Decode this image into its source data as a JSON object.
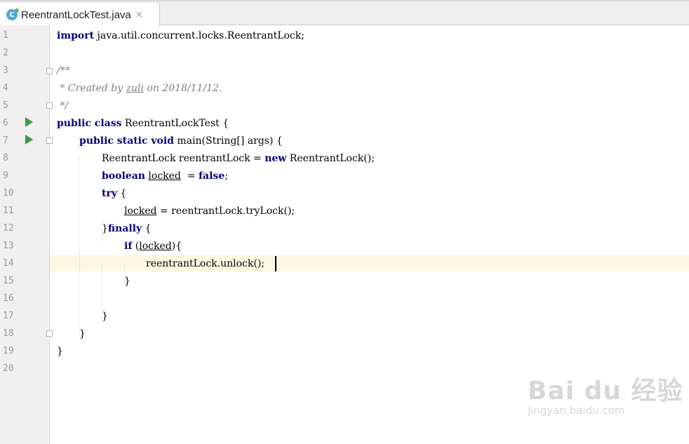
{
  "tab": {
    "icon_letter": "C",
    "label": "ReentrantLockTest.java",
    "close": "×"
  },
  "line_numbers": [
    "1",
    "2",
    "3",
    "4",
    "5",
    "6",
    "7",
    "8",
    "9",
    "10",
    "11",
    "12",
    "13",
    "14",
    "15",
    "16",
    "17",
    "18",
    "19",
    "20"
  ],
  "code": {
    "l1_kw": "import",
    "l1_rest": " java.util.concurrent.locks.ReentrantLock;",
    "l3": "/**",
    "l4_a": " * Created by ",
    "l4_name": "zuli",
    "l4_b": " on 2018/11/12.",
    "l5": " */",
    "l6_kw": "public class",
    "l6_rest": " ReentrantLockTest {",
    "l7_kw": "public static void",
    "l7_rest": " main(String[] args) {",
    "l8_a": "ReentrantLock reentrantLock = ",
    "l8_kw": "new",
    "l8_b": " ReentrantLock();",
    "l9_kw": "boolean",
    "l9_sp": " ",
    "l9_var": "locked",
    "l9_eq": "  = ",
    "l9_kw2": "false",
    "l9_end": ";",
    "l10_kw": "try",
    "l10_rest": " {",
    "l11_var": "locked",
    "l11_rest": " = reentrantLock.tryLock();",
    "l12_a": "}",
    "l12_kw": "finally",
    "l12_b": " {",
    "l13_kw": "if",
    "l13_a": " (",
    "l13_var": "locked",
    "l13_b": "){",
    "l14": "reentrantLock.unlock();",
    "l15": "}",
    "l17": "}",
    "l18": "}",
    "l19": "}"
  },
  "watermark": {
    "brand": "Bai du 经验",
    "url": "jingyan.baidu.com"
  }
}
